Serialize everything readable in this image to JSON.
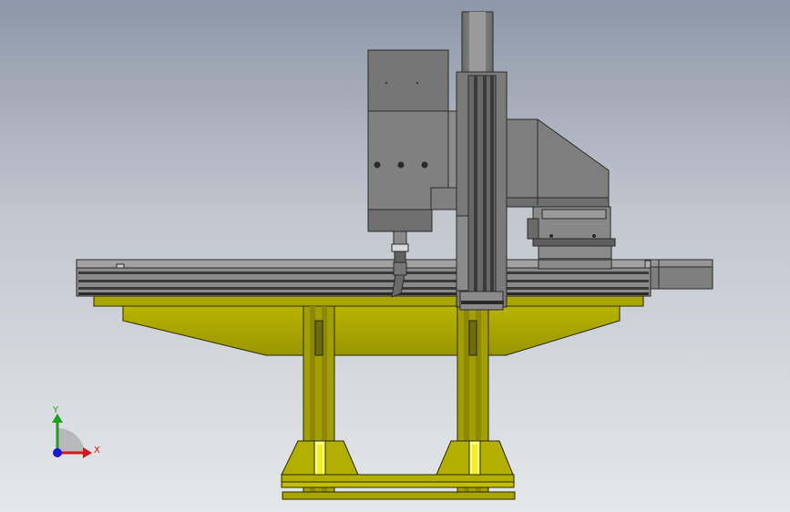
{
  "viewport": {
    "model": {
      "parts": [
        "gantry-beam",
        "left-machining-head",
        "vertical-slide-column",
        "right-motor-head",
        "rotary-table-assembly",
        "right-end-motor",
        "support-pedestal"
      ]
    },
    "triad": {
      "x_label": "X",
      "y_label": "Y"
    }
  },
  "colors": {
    "background_top": "#8d97a7",
    "background_bottom": "#e5e7ea",
    "steel": "#7a7a7a",
    "steel_light": "#9a9a9a",
    "steel_dark": "#4e4e4e",
    "frame_yellow": "#a7a300",
    "frame_yellow_light": "#c8c400",
    "frame_yellow_dark": "#7a7700",
    "axis_x": "#d11a1a",
    "axis_y": "#1aa31a",
    "axis_z": "#1a1ad1"
  },
  "icons": {
    "triad": "coordinate-triad-icon"
  }
}
